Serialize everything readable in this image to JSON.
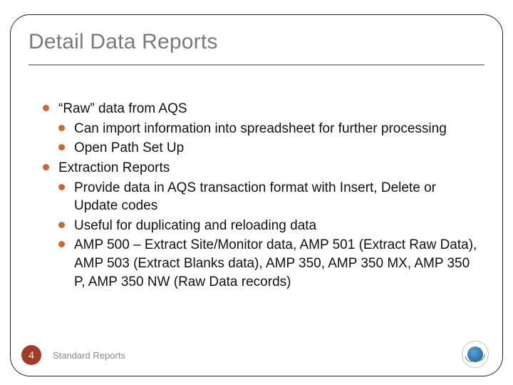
{
  "title": "Detail Data Reports",
  "bullets": {
    "b1": "“Raw” data from AQS",
    "b1_1": "Can import information into spreadsheet for further processing",
    "b1_2": "Open Path Set Up",
    "b2": "Extraction Reports",
    "b2_1": "Provide data in AQS transaction format with Insert, Delete or Update codes",
    "b2_2": "Useful for duplicating and reloading data",
    "b2_3": "AMP 500 – Extract Site/Monitor data, AMP 501 (Extract Raw Data), AMP 503 (Extract Blanks data), AMP 350, AMP 350 MX, AMP 350 P, AMP 350 NW (Raw Data records)"
  },
  "footer": {
    "page_number": "4",
    "label": "Standard Reports"
  }
}
